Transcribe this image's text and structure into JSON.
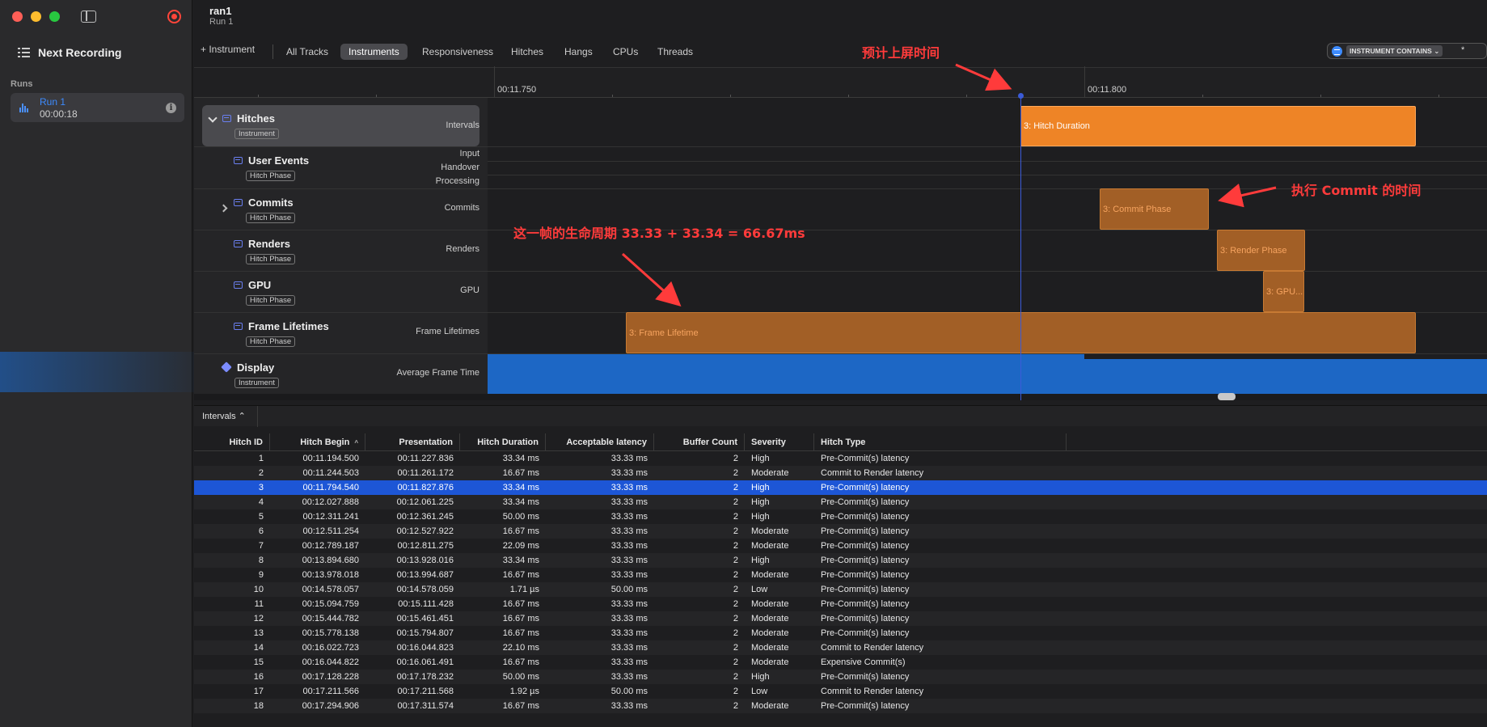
{
  "window": {
    "title": "ran1",
    "subtitle": "Run 1"
  },
  "sidebar": {
    "next_recording": "Next Recording",
    "runs_label": "Runs",
    "run": {
      "name": "Run 1",
      "duration": "00:00:18"
    }
  },
  "toolbar": {
    "add_instrument": "+ Instrument",
    "tabs": [
      "All Tracks",
      "Instruments",
      "Responsiveness",
      "Hitches",
      "Hangs",
      "CPUs",
      "Threads"
    ],
    "active_tab": "Instruments",
    "filter_token": "INSTRUMENT CONTAINS ⌄",
    "filter_value": "*"
  },
  "ruler": {
    "labels": [
      "00:11.750",
      "00:11.800"
    ]
  },
  "tracks": [
    {
      "name": "Hitches",
      "tag": "Instrument",
      "right": [
        "Intervals"
      ]
    },
    {
      "name": "User Events",
      "tag": "Hitch Phase",
      "right": [
        "Input",
        "Handover",
        "Processing"
      ]
    },
    {
      "name": "Commits",
      "tag": "Hitch Phase",
      "right": [
        "Commits"
      ]
    },
    {
      "name": "Renders",
      "tag": "Hitch Phase",
      "right": [
        "Renders"
      ]
    },
    {
      "name": "GPU",
      "tag": "Hitch Phase",
      "right": [
        "GPU"
      ]
    },
    {
      "name": "Frame Lifetimes",
      "tag": "Hitch Phase",
      "right": [
        "Frame Lifetimes"
      ]
    },
    {
      "name": "Display",
      "tag": "Instrument",
      "right": [
        "Average Frame Time"
      ]
    }
  ],
  "bars": {
    "hitch_duration": "3: Hitch Duration",
    "commit_phase": "3: Commit Phase",
    "render_phase": "3: Render Phase",
    "gpu": "3: GPU...",
    "frame_lifetime": "3: Frame Lifetime"
  },
  "annotations": {
    "expected_display": "预计上屏时间",
    "commit_time": "执行 Commit 的时间",
    "lifecycle": "这一帧的生命周期 33.33 + 33.34 = 66.67ms"
  },
  "detail": {
    "selector": "Intervals ⌃"
  },
  "table": {
    "columns": [
      "Hitch ID",
      "Hitch Begin",
      "Presentation",
      "Hitch Duration",
      "Acceptable latency",
      "Buffer Count",
      "Severity",
      "Hitch Type"
    ],
    "selected_index": 2,
    "rows": [
      [
        "1",
        "00:11.194.500",
        "00:11.227.836",
        "33.34 ms",
        "33.33 ms",
        "2",
        "High",
        "Pre-Commit(s) latency"
      ],
      [
        "2",
        "00:11.244.503",
        "00:11.261.172",
        "16.67 ms",
        "33.33 ms",
        "2",
        "Moderate",
        "Commit to Render latency"
      ],
      [
        "3",
        "00:11.794.540",
        "00:11.827.876",
        "33.34 ms",
        "33.33 ms",
        "2",
        "High",
        "Pre-Commit(s) latency"
      ],
      [
        "4",
        "00:12.027.888",
        "00:12.061.225",
        "33.34 ms",
        "33.33 ms",
        "2",
        "High",
        "Pre-Commit(s) latency"
      ],
      [
        "5",
        "00:12.311.241",
        "00:12.361.245",
        "50.00 ms",
        "33.33 ms",
        "2",
        "High",
        "Pre-Commit(s) latency"
      ],
      [
        "6",
        "00:12.511.254",
        "00:12.527.922",
        "16.67 ms",
        "33.33 ms",
        "2",
        "Moderate",
        "Pre-Commit(s) latency"
      ],
      [
        "7",
        "00:12.789.187",
        "00:12.811.275",
        "22.09 ms",
        "33.33 ms",
        "2",
        "Moderate",
        "Pre-Commit(s) latency"
      ],
      [
        "8",
        "00:13.894.680",
        "00:13.928.016",
        "33.34 ms",
        "33.33 ms",
        "2",
        "High",
        "Pre-Commit(s) latency"
      ],
      [
        "9",
        "00:13.978.018",
        "00:13.994.687",
        "16.67 ms",
        "33.33 ms",
        "2",
        "Moderate",
        "Pre-Commit(s) latency"
      ],
      [
        "10",
        "00:14.578.057",
        "00:14.578.059",
        "1.71 µs",
        "50.00 ms",
        "2",
        "Low",
        "Pre-Commit(s) latency"
      ],
      [
        "11",
        "00:15.094.759",
        "00:15.111.428",
        "16.67 ms",
        "33.33 ms",
        "2",
        "Moderate",
        "Pre-Commit(s) latency"
      ],
      [
        "12",
        "00:15.444.782",
        "00:15.461.451",
        "16.67 ms",
        "33.33 ms",
        "2",
        "Moderate",
        "Pre-Commit(s) latency"
      ],
      [
        "13",
        "00:15.778.138",
        "00:15.794.807",
        "16.67 ms",
        "33.33 ms",
        "2",
        "Moderate",
        "Pre-Commit(s) latency"
      ],
      [
        "14",
        "00:16.022.723",
        "00:16.044.823",
        "22.10 ms",
        "33.33 ms",
        "2",
        "Moderate",
        "Commit to Render latency"
      ],
      [
        "15",
        "00:16.044.822",
        "00:16.061.491",
        "16.67 ms",
        "33.33 ms",
        "2",
        "Moderate",
        "Expensive Commit(s)"
      ],
      [
        "16",
        "00:17.128.228",
        "00:17.178.232",
        "50.00 ms",
        "33.33 ms",
        "2",
        "High",
        "Pre-Commit(s) latency"
      ],
      [
        "17",
        "00:17.211.566",
        "00:17.211.568",
        "1.92 µs",
        "50.00 ms",
        "2",
        "Low",
        "Commit to Render latency"
      ],
      [
        "18",
        "00:17.294.906",
        "00:17.311.574",
        "16.67 ms",
        "33.33 ms",
        "2",
        "Moderate",
        "Pre-Commit(s) latency"
      ]
    ]
  }
}
